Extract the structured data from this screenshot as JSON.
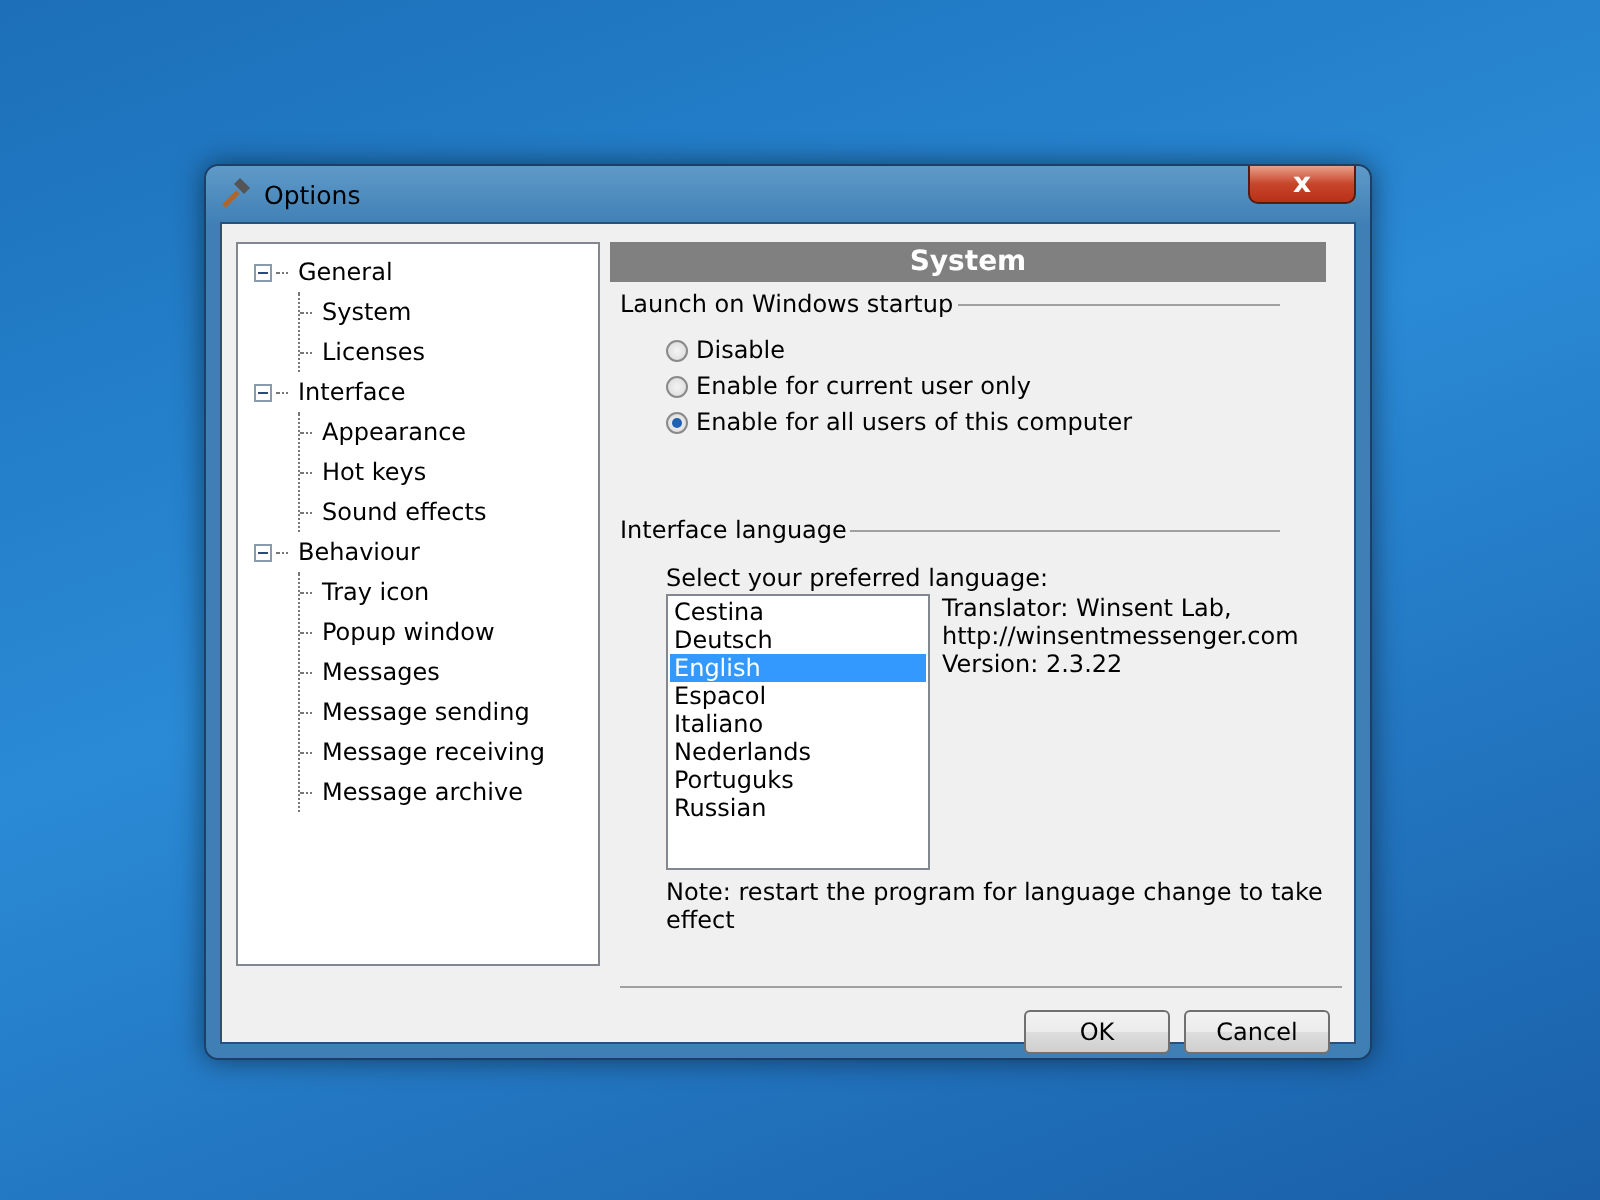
{
  "window": {
    "title": "Options",
    "close": "x"
  },
  "tree": [
    {
      "label": "General",
      "expanded": true,
      "children": [
        {
          "label": "System"
        },
        {
          "label": "Licenses"
        }
      ]
    },
    {
      "label": "Interface",
      "expanded": true,
      "children": [
        {
          "label": "Appearance"
        },
        {
          "label": "Hot keys"
        },
        {
          "label": "Sound effects"
        }
      ]
    },
    {
      "label": "Behaviour",
      "expanded": true,
      "children": [
        {
          "label": "Tray icon"
        },
        {
          "label": "Popup window"
        },
        {
          "label": "Messages"
        },
        {
          "label": "Message sending"
        },
        {
          "label": "Message receiving"
        },
        {
          "label": "Message archive"
        }
      ]
    }
  ],
  "page_title": "System",
  "startup": {
    "legend": "Launch on Windows startup",
    "options": [
      {
        "label": "Disable",
        "selected": false
      },
      {
        "label": "Enable for current user only",
        "selected": false
      },
      {
        "label": "Enable for all users of this computer",
        "selected": true
      }
    ]
  },
  "language": {
    "legend": "Interface language",
    "prompt": "Select your preferred language:",
    "items": [
      {
        "label": "Cestina",
        "selected": false
      },
      {
        "label": "Deutsch",
        "selected": false
      },
      {
        "label": "English",
        "selected": true
      },
      {
        "label": "Espacol",
        "selected": false
      },
      {
        "label": "Italiano",
        "selected": false
      },
      {
        "label": "Nederlands",
        "selected": false
      },
      {
        "label": "Portuguks",
        "selected": false
      },
      {
        "label": "Russian",
        "selected": false
      }
    ],
    "info": [
      "Translator: Winsent Lab,",
      "http://winsentmessenger.com",
      "Version: 2.3.22"
    ],
    "note": "Note: restart the program for language change to take effect"
  },
  "buttons": [
    "OK",
    "Cancel"
  ]
}
